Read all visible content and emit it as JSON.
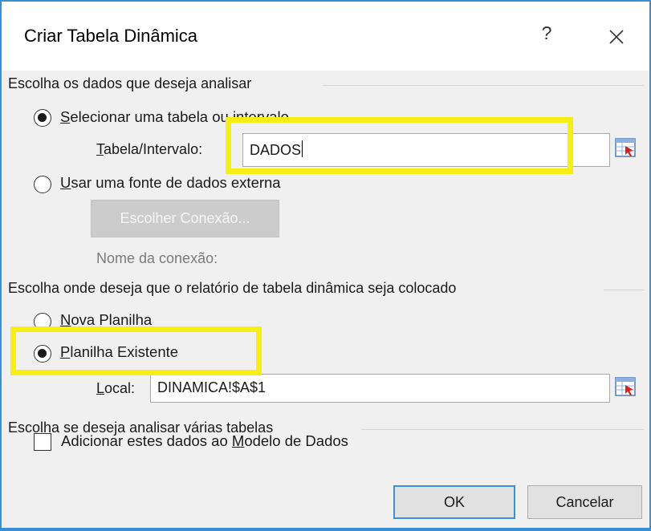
{
  "dialog": {
    "title": "Criar Tabela Dinâmica",
    "help_label": "?",
    "close_icon": "close-icon"
  },
  "source_group": {
    "label": "Escolha os dados que deseja analisar",
    "option_select": {
      "underlined": "S",
      "rest": "elecionar uma tabela ou intervalo",
      "checked": true
    },
    "range_label_underlined": "T",
    "range_label_rest": "abela/Intervalo:",
    "range_value": "DADOS",
    "option_external": {
      "underlined": "U",
      "rest": "sar uma fonte de dados externa",
      "checked": false
    },
    "choose_connection_label": "Escolher Conexão...",
    "connection_name_label": "Nome da conexão:"
  },
  "placement_group": {
    "label": "Escolha onde deseja que o relatório de tabela dinâmica seja colocado",
    "option_new": {
      "underlined": "N",
      "rest": "ova Planilha",
      "checked": false
    },
    "option_existing": {
      "underlined": "P",
      "rest": "lanilha Existente",
      "checked": true
    },
    "location_label_underlined": "L",
    "location_label_rest": "ocal:",
    "location_value": "DINAMICA!$A$1"
  },
  "multi_group": {
    "label": "Escolha se deseja analisar várias tabelas",
    "checkbox_prefix": "Adicionar estes dados ao ",
    "checkbox_underlined": "M",
    "checkbox_suffix": "odelo de Dados",
    "checked": false
  },
  "buttons": {
    "ok": "OK",
    "cancel": "Cancelar"
  },
  "colors": {
    "accent": "#3c8fd3",
    "highlight": "#f5ef16"
  },
  "icons": [
    "close-icon",
    "range-picker-icon"
  ]
}
